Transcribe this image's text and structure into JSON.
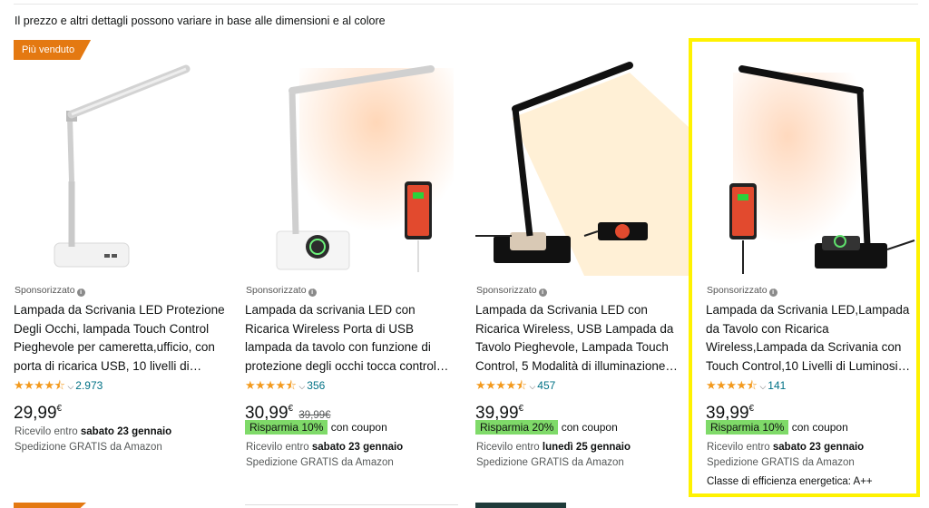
{
  "notice": "Il prezzo e altri dettagli possono variare in base alle dimensioni e al colore",
  "products": [
    {
      "badge": "Più venduto",
      "sponsored": "Sponsorizzato",
      "title": "Lampada da Scrivania LED Protezione Degli Occhi, lampada Touch Control Pieghevole per cameretta,ufficio, con porta di ricarica USB, 10 livelli di…",
      "stars": "★★★★⯪",
      "rating_count": "2.973",
      "price_int": "29,99",
      "price_cur": "€",
      "delivery_prefix": "Ricevilo entro",
      "delivery_date": "sabato 23 gennaio",
      "shipping": "Spedizione GRATIS da Amazon"
    },
    {
      "sponsored": "Sponsorizzato",
      "title": "Lampada da scrivania LED con Ricarica Wireless Porta di USB lampada da tavolo con funzione di protezione degli occhi tocca control…",
      "stars": "★★★★⯪",
      "rating_count": "356",
      "price_int": "30,99",
      "price_cur": "€",
      "old_price": "39,99€",
      "coupon": "Risparmia 10%",
      "coupon_suffix": "con coupon",
      "delivery_prefix": "Ricevilo entro",
      "delivery_date": "sabato 23 gennaio",
      "shipping": "Spedizione GRATIS da Amazon"
    },
    {
      "sponsored": "Sponsorizzato",
      "title": "Lampada da Scrivania LED con Ricarica Wireless, USB Lampada da Tavolo Pieghevole, Lampada Touch Control, 5 Modalità di illuminazione…",
      "stars": "★★★★⯪",
      "rating_count": "457",
      "price_int": "39,99",
      "price_cur": "€",
      "coupon": "Risparmia 20%",
      "coupon_suffix": "con coupon",
      "delivery_prefix": "Ricevilo entro",
      "delivery_date": "lunedì 25 gennaio",
      "shipping": "Spedizione GRATIS da Amazon"
    },
    {
      "sponsored": "Sponsorizzato",
      "title": "Lampada da Scrivania LED,Lampada da Tavolo con Ricarica Wireless,Lampada da Scrivania con Touch Control,10 Livelli di Luminosi…",
      "stars": "★★★★⯪",
      "rating_count": "141",
      "price_int": "39,99",
      "price_cur": "€",
      "coupon": "Risparmia 10%",
      "coupon_suffix": "con coupon",
      "delivery_prefix": "Ricevilo entro",
      "delivery_date": "sabato 23 gennaio",
      "shipping": "Spedizione GRATIS da Amazon",
      "energy": "Classe di efficienza energetica: A++"
    }
  ],
  "colors": {
    "badge": "#E47911",
    "coupon": "#7FDA69",
    "link": "#007185",
    "star": "#F39A1E",
    "highlight": "#FFF200"
  },
  "icons": {
    "info": "info-icon",
    "chevron": "chevron-down-icon",
    "star": "star-icon"
  }
}
